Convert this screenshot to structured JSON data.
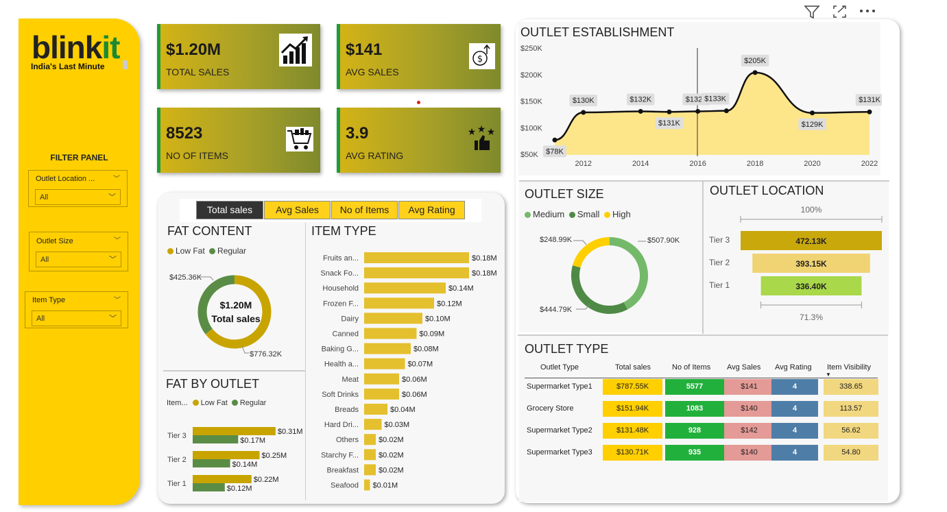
{
  "header_icons": {
    "filter": "filter-icon",
    "focus": "focus-mode-icon",
    "more": "more-options-icon"
  },
  "brand": {
    "logo_main": "blink",
    "logo_accent": "it",
    "tagline": "India's Last Minute"
  },
  "filter_panel": {
    "title": "FILTER PANEL",
    "slicers": [
      {
        "label": "Outlet Location ...",
        "value": "All"
      },
      {
        "label": "Outlet Size",
        "value": "All"
      },
      {
        "label": "Item Type",
        "value": "All"
      }
    ]
  },
  "kpis": [
    {
      "value": "$1.20M",
      "label": "TOTAL SALES",
      "icon": "chart-up-icon"
    },
    {
      "value": "$141",
      "label": "AVG SALES",
      "icon": "money-growth-icon"
    },
    {
      "value": "8523",
      "label": "NO OF ITEMS",
      "icon": "shopping-cart-icon"
    },
    {
      "value": "3.9",
      "label": "AVG RATING",
      "icon": "rating-stars-icon"
    }
  ],
  "tabs": [
    "Total sales",
    "Avg Sales",
    "No of Items",
    "Avg Rating"
  ],
  "fat_content": {
    "title": "FAT CONTENT",
    "legend": [
      "Low Fat",
      "Regular"
    ],
    "center_value": "$1.20M",
    "center_label": "Total sales",
    "labels": {
      "regular": "$425.36K",
      "low_fat": "$776.32K"
    }
  },
  "fat_by_outlet": {
    "title": "FAT BY OUTLET",
    "legend_title": "Item...",
    "legend": [
      "Low Fat",
      "Regular"
    ],
    "rows": [
      {
        "tier": "Tier 3",
        "low": "$0.31M",
        "reg": "$0.17M"
      },
      {
        "tier": "Tier 2",
        "low": "$0.25M",
        "reg": "$0.14M"
      },
      {
        "tier": "Tier 1",
        "low": "$0.22M",
        "reg": "$0.12M"
      }
    ]
  },
  "item_type": {
    "title": "ITEM TYPE",
    "items": [
      {
        "name": "Fruits an...",
        "label": "$0.18M"
      },
      {
        "name": "Snack Fo...",
        "label": "$0.18M"
      },
      {
        "name": "Household",
        "label": "$0.14M"
      },
      {
        "name": "Frozen F...",
        "label": "$0.12M"
      },
      {
        "name": "Dairy",
        "label": "$0.10M"
      },
      {
        "name": "Canned",
        "label": "$0.09M"
      },
      {
        "name": "Baking G...",
        "label": "$0.08M"
      },
      {
        "name": "Health a...",
        "label": "$0.07M"
      },
      {
        "name": "Meat",
        "label": "$0.06M"
      },
      {
        "name": "Soft Drinks",
        "label": "$0.06M"
      },
      {
        "name": "Breads",
        "label": "$0.04M"
      },
      {
        "name": "Hard Dri...",
        "label": "$0.03M"
      },
      {
        "name": "Others",
        "label": "$0.02M"
      },
      {
        "name": "Starchy F...",
        "label": "$0.02M"
      },
      {
        "name": "Breakfast",
        "label": "$0.02M"
      },
      {
        "name": "Seafood",
        "label": "$0.01M"
      }
    ]
  },
  "outlet_establishment": {
    "title": "OUTLET ESTABLISHMENT",
    "y_ticks": [
      "$250K",
      "$200K",
      "$150K",
      "$100K",
      "$50K"
    ],
    "x_ticks": [
      "2012",
      "2014",
      "2016",
      "2018",
      "2020",
      "2022"
    ],
    "point_labels": [
      "$78K",
      "$130K",
      "$132K",
      "$131K",
      "$132K",
      "$133K",
      "$205K",
      "$129K",
      "$131K"
    ]
  },
  "outlet_size": {
    "title": "OUTLET SIZE",
    "legend": [
      "Medium",
      "Small",
      "High"
    ],
    "labels": {
      "high": "$248.99K",
      "medium": "$507.90K",
      "small": "$444.79K"
    }
  },
  "outlet_location": {
    "title": "OUTLET LOCATION",
    "top_pct": "100%",
    "bottom_pct": "71.3%",
    "rows": [
      {
        "tier": "Tier 3",
        "label": "472.13K"
      },
      {
        "tier": "Tier 2",
        "label": "393.15K"
      },
      {
        "tier": "Tier 1",
        "label": "336.40K"
      }
    ]
  },
  "outlet_type": {
    "title": "OUTLET TYPE",
    "headers": [
      "Outlet Type",
      "Total sales",
      "No of Items",
      "Avg Sales",
      "Avg Rating",
      "Item Visibility"
    ],
    "rows": [
      [
        "Supermarket Type1",
        "$787.55K",
        "5577",
        "$141",
        "4",
        "338.65"
      ],
      [
        "Grocery Store",
        "$151.94K",
        "1083",
        "$140",
        "4",
        "113.57"
      ],
      [
        "Supermarket Type2",
        "$131.48K",
        "928",
        "$142",
        "4",
        "56.62"
      ],
      [
        "Supermarket Type3",
        "$130.71K",
        "935",
        "$140",
        "4",
        "54.80"
      ]
    ]
  },
  "chart_data": [
    {
      "type": "pie",
      "title": "FAT CONTENT",
      "categories": [
        "Low Fat",
        "Regular"
      ],
      "values": [
        776.32,
        425.36
      ],
      "unit": "$K",
      "colors": [
        "#c8a400",
        "#5a8c46"
      ]
    },
    {
      "type": "bar",
      "title": "FAT BY OUTLET",
      "categories": [
        "Tier 3",
        "Tier 2",
        "Tier 1"
      ],
      "series": [
        {
          "name": "Low Fat",
          "values": [
            0.31,
            0.25,
            0.22
          ]
        },
        {
          "name": "Regular",
          "values": [
            0.17,
            0.14,
            0.12
          ]
        }
      ],
      "unit": "$M"
    },
    {
      "type": "bar",
      "title": "ITEM TYPE",
      "categories": [
        "Fruits an...",
        "Snack Fo...",
        "Household",
        "Frozen F...",
        "Dairy",
        "Canned",
        "Baking G...",
        "Health a...",
        "Meat",
        "Soft Drinks",
        "Breads",
        "Hard Dri...",
        "Others",
        "Starchy F...",
        "Breakfast",
        "Seafood"
      ],
      "values": [
        0.18,
        0.18,
        0.14,
        0.12,
        0.1,
        0.09,
        0.08,
        0.07,
        0.06,
        0.06,
        0.04,
        0.03,
        0.02,
        0.02,
        0.02,
        0.01
      ],
      "unit": "$M"
    },
    {
      "type": "area",
      "title": "OUTLET ESTABLISHMENT",
      "x": [
        2011,
        2012,
        2014,
        2015,
        2016,
        2017,
        2018,
        2020,
        2022
      ],
      "values": [
        78,
        130,
        132,
        131,
        132,
        133,
        205,
        129,
        131
      ],
      "unit": "$K",
      "xlim": [
        2011,
        2022
      ],
      "ylim": [
        50,
        250
      ]
    },
    {
      "type": "pie",
      "title": "OUTLET SIZE",
      "categories": [
        "Medium",
        "Small",
        "High"
      ],
      "values": [
        507.9,
        444.79,
        248.99
      ],
      "unit": "$K",
      "colors": [
        "#74b96a",
        "#4e8a45",
        "#ffcf00"
      ]
    },
    {
      "type": "bar",
      "title": "OUTLET LOCATION",
      "categories": [
        "Tier 3",
        "Tier 2",
        "Tier 1"
      ],
      "values": [
        472.13,
        393.15,
        336.4
      ],
      "unit": "K",
      "colors": [
        "#c9a80c",
        "#f0d372",
        "#a9d84a"
      ]
    }
  ]
}
